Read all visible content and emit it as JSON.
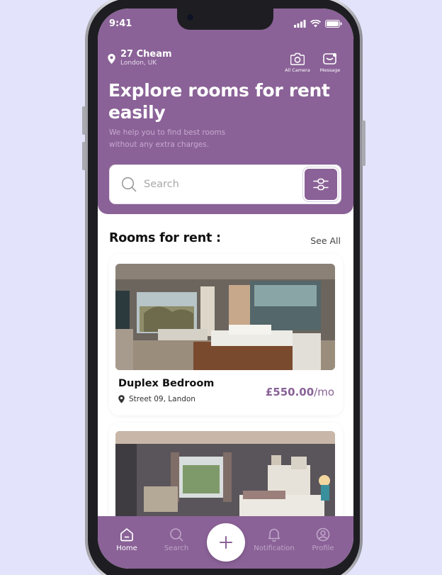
{
  "status_bar": {
    "time": "9:41"
  },
  "header": {
    "location_title": "27 Cheam",
    "location_subtitle": "London, UK",
    "actions": [
      {
        "label": "All Camera",
        "icon": "camera-icon"
      },
      {
        "label": "Message",
        "icon": "message-icon"
      }
    ],
    "title": "Explore rooms for rent easily",
    "subtitle": "We help you to find best rooms without any extra charges."
  },
  "search": {
    "placeholder": "Search",
    "value": ""
  },
  "section": {
    "title": "Rooms for rent :",
    "see_all": "See All"
  },
  "rooms": [
    {
      "name": "Duplex Bedroom",
      "address": "Street 09, Landon",
      "price": "£550.00",
      "period": "/mo"
    },
    {
      "name": "",
      "address": "",
      "price": "",
      "period": ""
    }
  ],
  "bottom_nav": {
    "items": [
      {
        "label": "Home",
        "icon": "home-icon",
        "active": true
      },
      {
        "label": "Search",
        "icon": "search-icon",
        "active": false
      },
      {
        "label": "Notification",
        "icon": "bell-icon",
        "active": false
      },
      {
        "label": "Profile",
        "icon": "profile-icon",
        "active": false
      }
    ],
    "fab_icon": "plus-icon"
  },
  "colors": {
    "accent": "#8a6297",
    "background": "#e3e3fb"
  }
}
